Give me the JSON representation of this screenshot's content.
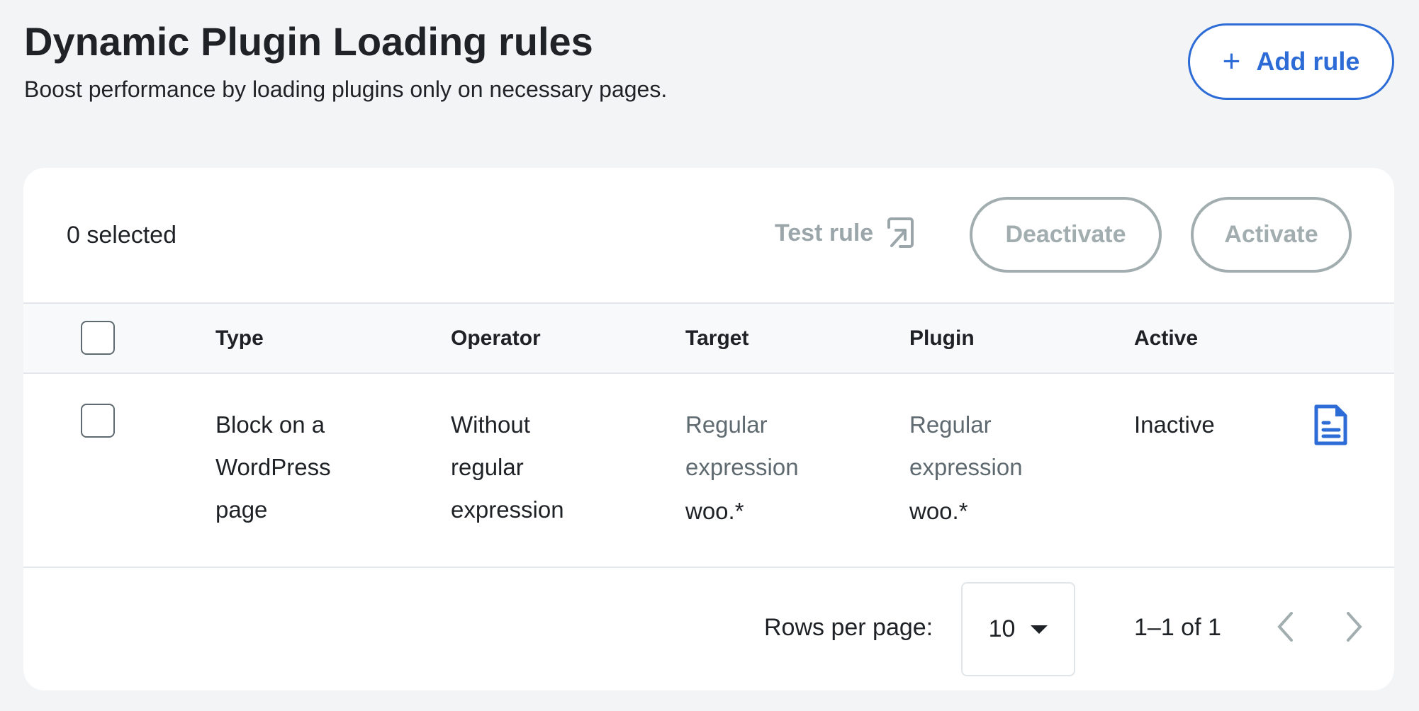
{
  "header": {
    "title": "Dynamic Plugin Loading rules",
    "subtitle": "Boost performance by loading plugins only on necessary pages.",
    "add_rule_label": "Add rule"
  },
  "toolbar": {
    "selected_text": "0 selected",
    "test_rule_label": "Test rule",
    "deactivate_label": "Deactivate",
    "activate_label": "Activate"
  },
  "table": {
    "columns": [
      "Type",
      "Operator",
      "Target",
      "Plugin",
      "Active"
    ],
    "rows": [
      {
        "type": "Block on a WordPress page",
        "operator": "Without regular expression",
        "target_kind": "Regular expression",
        "target_value": "woo.*",
        "plugin_kind": "Regular expression",
        "plugin_value": "woo.*",
        "active": "Inactive"
      }
    ]
  },
  "pagination": {
    "rows_per_page_label": "Rows per page:",
    "rows_per_page": "10",
    "range": "1–1 of 1"
  },
  "colors": {
    "accent": "#2d6cd6",
    "disabled": "#a2adb0"
  }
}
